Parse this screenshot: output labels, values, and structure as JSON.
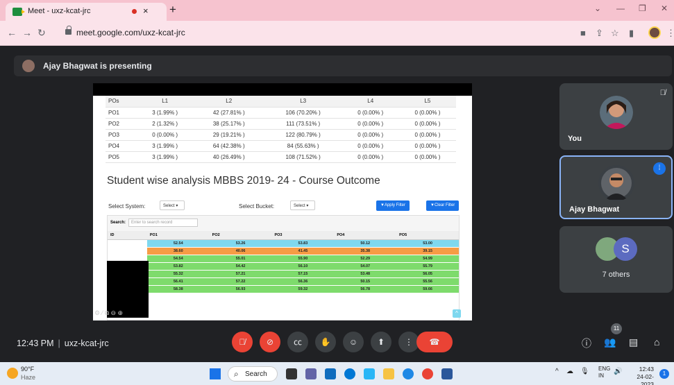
{
  "browser": {
    "tab_title": "Meet - uxz-kcat-jrc",
    "tab_close": "×",
    "new_tab": "+",
    "url": "meet.google.com/uxz-kcat-jrc",
    "icons": [
      "back-icon",
      "forward-icon",
      "reload-icon",
      "lock-icon",
      "share-icon",
      "star-icon",
      "sidebar-icon",
      "profile-icon",
      "menu-icon"
    ]
  },
  "presenting": {
    "text": "Ajay Bhagwat is presenting"
  },
  "po_table": {
    "headers": [
      "POs",
      "L1",
      "L2",
      "L3",
      "L4",
      "L5"
    ],
    "rows": [
      [
        "PO1",
        "3 (1.99% )",
        "42 (27.81% )",
        "106 (70.20% )",
        "0 (0.00% )",
        "0 (0.00% )"
      ],
      [
        "PO2",
        "2 (1.32% )",
        "38 (25.17% )",
        "111 (73.51% )",
        "0 (0.00% )",
        "0 (0.00% )"
      ],
      [
        "PO3",
        "0 (0.00% )",
        "29 (19.21% )",
        "122 (80.79% )",
        "0 (0.00% )",
        "0 (0.00% )"
      ],
      [
        "PO4",
        "3 (1.99% )",
        "64 (42.38% )",
        "84 (55.63% )",
        "0 (0.00% )",
        "0 (0.00% )"
      ],
      [
        "PO5",
        "3 (1.99% )",
        "40 (26.49% )",
        "108 (71.52% )",
        "0 (0.00% )",
        "0 (0.00% )"
      ]
    ]
  },
  "analysis": {
    "title": "Student wise analysis MBBS 2019- 24 - Course Outcome",
    "select_system_label": "Select System:",
    "select_system_value": "Select ▾",
    "select_bucket_label": "Select Bucket:",
    "select_bucket_value": "Select ▾",
    "apply_filter": "▼Apply Filter",
    "clear_filter": "▼Clear Filter",
    "search_label": "Search:",
    "search_placeholder": "Enter to search record",
    "headers": [
      "ID",
      "PO1",
      "PO2",
      "PO3",
      "PO4",
      "PO5"
    ],
    "rows": [
      {
        "color": "cyan",
        "cells": [
          "",
          "52.54",
          "53.26",
          "53.83",
          "50.12",
          "53.00"
        ]
      },
      {
        "color": "orange",
        "cells": [
          "",
          "38.60",
          "40.06",
          "41.45",
          "35.38",
          "39.15"
        ]
      },
      {
        "color": "green",
        "cells": [
          "",
          "54.54",
          "55.01",
          "55.90",
          "52.29",
          "54.99"
        ]
      },
      {
        "color": "green",
        "cells": [
          "",
          "53.82",
          "54.42",
          "56.10",
          "54.07",
          "55.79"
        ]
      },
      {
        "color": "green",
        "cells": [
          "",
          "55.32",
          "57.21",
          "57.15",
          "53.48",
          "56.05"
        ]
      },
      {
        "color": "green",
        "cells": [
          "",
          "56.41",
          "57.22",
          "56.36",
          "50.15",
          "55.56"
        ]
      },
      {
        "color": "green",
        "cells": [
          "",
          "58.38",
          "56.93",
          "59.32",
          "56.78",
          "59.66"
        ]
      }
    ]
  },
  "participants": {
    "you": {
      "name": "You"
    },
    "ajay": {
      "name": "Ajay Bhagwat"
    },
    "others": {
      "label": "7 others",
      "initial": "S"
    }
  },
  "meeting": {
    "time": "12:43 PM",
    "code": "uxz-kcat-jrc",
    "participant_count": "11"
  },
  "taskbar": {
    "temperature": "90°F",
    "weather": "Haze",
    "search": "Search",
    "lang_line1": "ENG",
    "lang_line2": "IN",
    "time": "12:43",
    "date": "24-02-2023",
    "notifications": "1"
  },
  "colors": {
    "cyan": "#7fd8ef",
    "orange": "#f79c45",
    "green": "#7edb6c",
    "accent": "#1a73e8",
    "end_call": "#ea4335"
  }
}
